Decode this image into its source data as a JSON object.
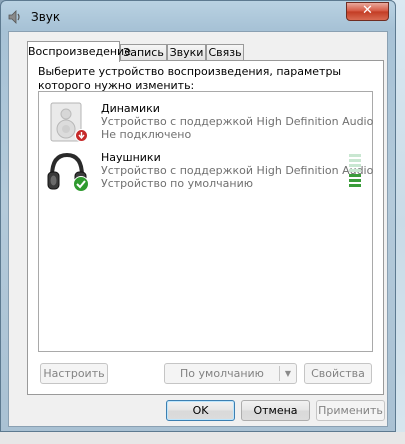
{
  "window": {
    "title": "Звук",
    "close_glyph": "✕"
  },
  "tabs": [
    {
      "label": "Воспроизведение",
      "active": true
    },
    {
      "label": "Запись",
      "active": false
    },
    {
      "label": "Звуки",
      "active": false
    },
    {
      "label": "Связь",
      "active": false
    }
  ],
  "instruction": "Выберите устройство воспроизведения, параметры которого нужно изменить:",
  "devices": [
    {
      "name": "Динамики",
      "description": "Устройство с поддержкой High Definition Audio",
      "status": "Не подключено",
      "icon": "speaker-icon",
      "badge": "disconnected-badge-icon"
    },
    {
      "name": "Наушники",
      "description": "Устройство с поддержкой High Definition Audio",
      "status": "Устройство по умолчанию",
      "icon": "headphones-icon",
      "badge": "default-check-badge-icon"
    }
  ],
  "buttons": {
    "configure": "Настроить",
    "set_default": "По умолчанию",
    "properties": "Свойства",
    "ok": "OK",
    "cancel": "Отмена",
    "apply": "Применить"
  },
  "colors": {
    "level_active": "#3a9c3a",
    "level_idle": "#c9e7d1",
    "check_badge": "#2f9a2f",
    "disconnected_badge": "#c62a2a"
  }
}
